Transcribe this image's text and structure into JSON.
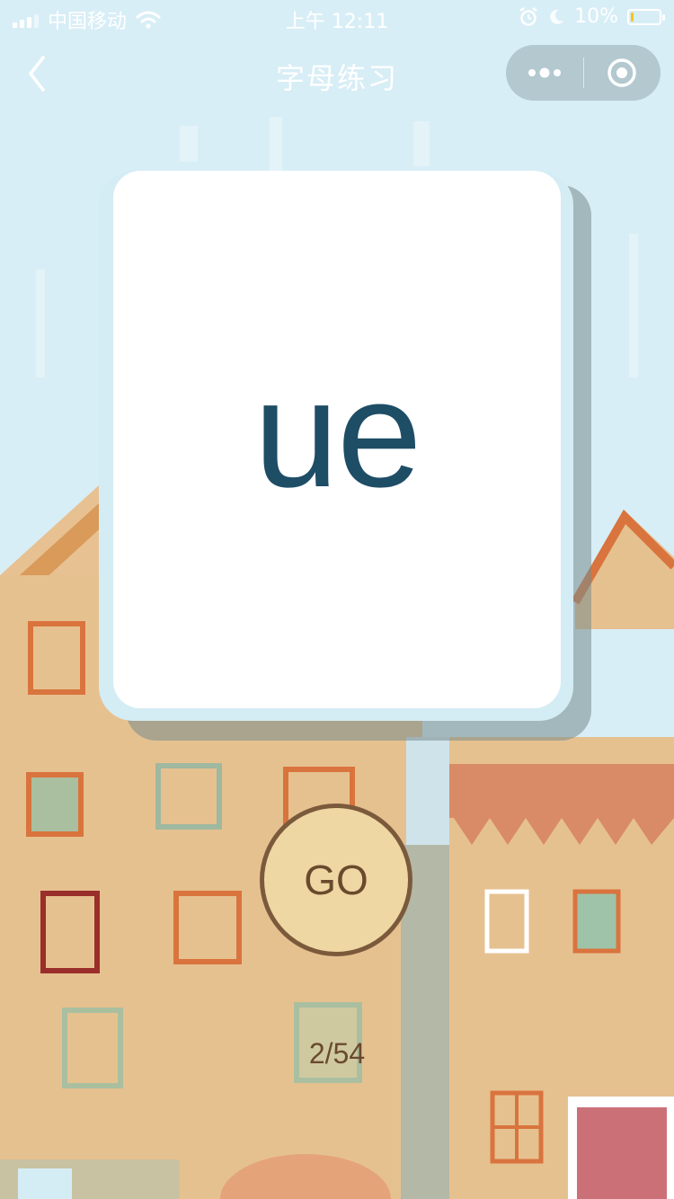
{
  "status_bar": {
    "carrier": "中国移动",
    "time": "上午 12:11",
    "battery_text": "10%",
    "battery_level": 0.1
  },
  "nav": {
    "title": "字母练习"
  },
  "card": {
    "letter": "ue"
  },
  "go_button": {
    "label": "GO"
  },
  "progress": {
    "text": "2/54",
    "current": 2,
    "total": 54
  },
  "colors": {
    "sky": "#d8eef6",
    "card_text": "#1e4d66",
    "go_fill": "#eed7a3",
    "go_border": "#7b5a3c",
    "battery_fill": "#f5c518"
  }
}
